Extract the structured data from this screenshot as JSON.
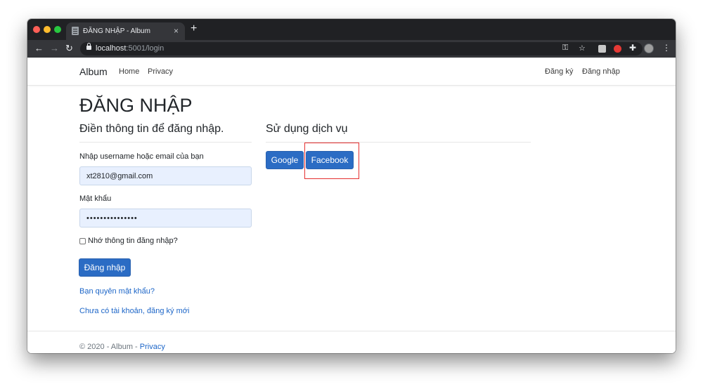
{
  "browser": {
    "tab_title": "ĐĂNG NHẬP - Album",
    "tab_close": "×",
    "new_tab": "+",
    "url_host": "localhost",
    "url_rest": ":5001/login",
    "back": "←",
    "forward": "→",
    "reload": "↻",
    "key": "⚿",
    "star": "☆",
    "puzzle": "✚",
    "menu": "⋮"
  },
  "navbar": {
    "brand": "Album",
    "links": [
      "Home",
      "Privacy"
    ],
    "right_links": [
      "Đăng ký",
      "Đăng nhập"
    ]
  },
  "page": {
    "title": "ĐĂNG NHẬP",
    "form_heading": "Điền thông tin để đăng nhập.",
    "services_heading": "Sử dụng dịch vụ",
    "email_label": "Nhập username hoặc email của bạn",
    "email_value": "xt2810@gmail.com",
    "password_label": "Mật khẩu",
    "password_value": "•••••••••••••••",
    "remember_label": "Nhớ thông tin đăng nhập?",
    "login_button": "Đăng nhập",
    "forgot_link": "Bạn quyên mật khẩu?",
    "register_link": "Chưa có tài khoản, đăng ký mới",
    "services": [
      "Google",
      "Facebook"
    ]
  },
  "footer": {
    "text": "© 2020 - Album - ",
    "privacy": "Privacy"
  },
  "colors": {
    "accent": "#2b6cc4",
    "link": "#1d66c8",
    "highlight": "#e53030"
  }
}
